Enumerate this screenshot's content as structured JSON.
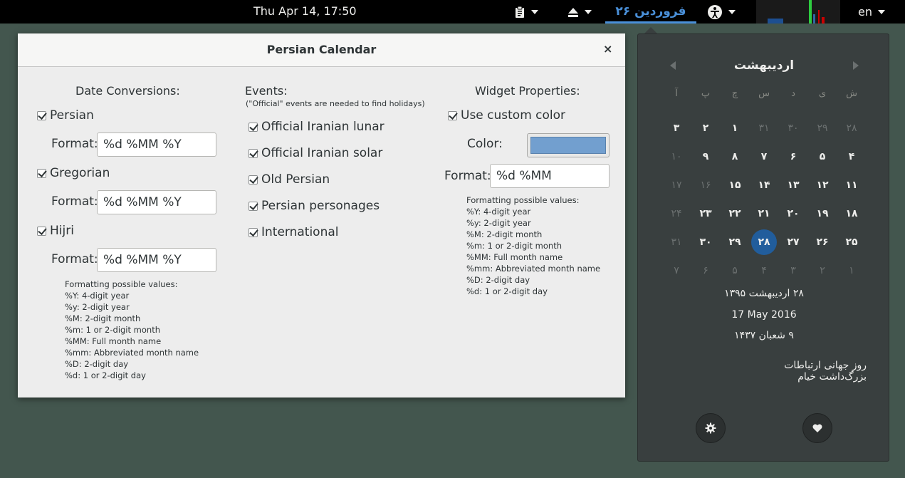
{
  "topbar": {
    "clock": "Thu Apr 14, 17:50",
    "date_indicator": "۲۶ فروردین",
    "language": "en",
    "icons": [
      "clipboard-icon",
      "eject-icon",
      "accessibility-icon",
      "system-monitor-icon"
    ]
  },
  "dialog": {
    "title": "Persian Calendar",
    "close": "×",
    "date_conversions": {
      "heading": "Date Conversions:",
      "format_label": "Format:",
      "items": [
        {
          "label": "Persian",
          "checked": true,
          "format": "%d %MM %Y"
        },
        {
          "label": "Gregorian",
          "checked": true,
          "format": "%d %MM %Y"
        },
        {
          "label": "Hijri",
          "checked": true,
          "format": "%d %MM %Y"
        }
      ],
      "help": [
        "Formatting possible values:",
        "%Y: 4-digit year",
        "%y: 2-digit year",
        "%M: 2-digit month",
        "%m: 1 or 2-digit month",
        "%MM: Full month name",
        "%mm: Abbreviated month name",
        "%D: 2-digit day",
        "%d: 1 or 2-digit day"
      ]
    },
    "events": {
      "heading": "Events:",
      "note": "(\"Official\" events are needed to find holidays)",
      "items": [
        {
          "label": "Official Iranian lunar",
          "checked": true
        },
        {
          "label": "Official Iranian solar",
          "checked": true
        },
        {
          "label": "Old Persian",
          "checked": true
        },
        {
          "label": "Persian personages",
          "checked": true
        },
        {
          "label": "International",
          "checked": true
        }
      ]
    },
    "widget": {
      "heading": "Widget Properties:",
      "custom_color_label": "Use custom color",
      "custom_color_checked": true,
      "color_label": "Color:",
      "color_value": "#729fcf",
      "format_label": "Format:",
      "format_value": "%d %MM",
      "help": [
        "Formatting possible values:",
        "%Y: 4-digit year",
        "%y: 2-digit year",
        "%M: 2-digit month",
        "%m: 1 or 2-digit month",
        "%MM: Full month name",
        "%mm: Abbreviated month name",
        "%D: 2-digit day",
        "%d: 1 or 2-digit day"
      ]
    }
  },
  "calendar": {
    "month": "اردیبهشت",
    "weekdays": [
      "ش",
      "ی",
      "د",
      "س",
      "چ",
      "پ",
      "آ"
    ],
    "weeks": [
      [
        {
          "d": "۲۸",
          "dim": true
        },
        {
          "d": "۲۹",
          "dim": true
        },
        {
          "d": "۳۰",
          "dim": true
        },
        {
          "d": "۳۱",
          "dim": true
        },
        {
          "d": "۱"
        },
        {
          "d": "۲"
        },
        {
          "d": "۳"
        }
      ],
      [
        {
          "d": "۴"
        },
        {
          "d": "۵"
        },
        {
          "d": "۶"
        },
        {
          "d": "۷"
        },
        {
          "d": "۸"
        },
        {
          "d": "۹"
        },
        {
          "d": "۱۰",
          "dim": true
        }
      ],
      [
        {
          "d": "۱۱"
        },
        {
          "d": "۱۲"
        },
        {
          "d": "۱۳"
        },
        {
          "d": "۱۴"
        },
        {
          "d": "۱۵"
        },
        {
          "d": "۱۶",
          "dim": true
        },
        {
          "d": "۱۷",
          "dim": true
        }
      ],
      [
        {
          "d": "۱۸"
        },
        {
          "d": "۱۹"
        },
        {
          "d": "۲۰"
        },
        {
          "d": "۲۱"
        },
        {
          "d": "۲۲"
        },
        {
          "d": "۲۳"
        },
        {
          "d": "۲۴",
          "dim": true
        }
      ],
      [
        {
          "d": "۲۵"
        },
        {
          "d": "۲۶"
        },
        {
          "d": "۲۷"
        },
        {
          "d": "۲۸",
          "today": true
        },
        {
          "d": "۲۹"
        },
        {
          "d": "۳۰"
        },
        {
          "d": "۳۱",
          "dim": true
        }
      ],
      [
        {
          "d": "۱",
          "dim": true
        },
        {
          "d": "۲",
          "dim": true
        },
        {
          "d": "۳",
          "dim": true
        },
        {
          "d": "۴",
          "dim": true
        },
        {
          "d": "۵",
          "dim": true
        },
        {
          "d": "۶",
          "dim": true
        },
        {
          "d": "۷",
          "dim": true
        }
      ]
    ],
    "persian_date": "۲۸ اردیبهشت ۱۳۹۵",
    "gregorian_date": "17 May 2016",
    "hijri_date": "۹ شعبان ۱۴۳۷",
    "events": [
      "روز جهانی ارتباطات",
      "بزرگ‌داشت خیام"
    ],
    "settings_icon": "gear-icon",
    "favorite_icon": "heart-icon"
  }
}
